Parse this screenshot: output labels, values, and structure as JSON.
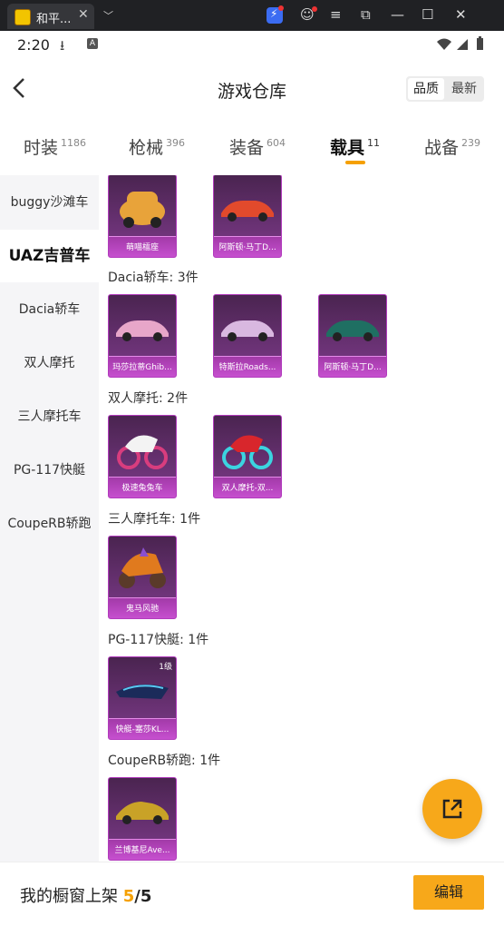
{
  "browser": {
    "tab_title": "和平...",
    "tab_close": "✕",
    "tab_dropdown": "﹀",
    "controls": [
      "≡",
      "⧉",
      "—",
      "☐",
      "✕"
    ],
    "colors": {
      "chrome_bg": "#202124",
      "ext_icon": "#3b6cf2"
    }
  },
  "status_bar": {
    "time": "2:20",
    "a_badge": "A",
    "icons": [
      "download-icon",
      "a-badge-icon",
      "wifi-icon",
      "signal-icon",
      "battery-icon"
    ]
  },
  "header": {
    "title": "游戏仓库",
    "sort_options": [
      "品质",
      "最新"
    ],
    "active_sort": "品质"
  },
  "category_tabs": [
    {
      "label": "时装",
      "count": "1186"
    },
    {
      "label": "枪械",
      "count": "396"
    },
    {
      "label": "装备",
      "count": "604"
    },
    {
      "label": "载具",
      "count": "11",
      "active": true
    },
    {
      "label": "战备",
      "count": "239"
    }
  ],
  "sidebar": {
    "items": [
      {
        "label": "buggy沙滩车"
      },
      {
        "label": "UAZ吉普车",
        "active": true
      },
      {
        "label": "Dacia轿车"
      },
      {
        "label": "双人摩托"
      },
      {
        "label": "三人摩托车"
      },
      {
        "label": "PG-117快艇"
      },
      {
        "label": "CoupeRB轿跑"
      }
    ]
  },
  "sections": [
    {
      "title": "",
      "items": [
        {
          "name": "萌喵檑座",
          "vehicle": "beetle-car",
          "color": "#e8a33a"
        },
        {
          "name": "阿斯顿·马丁D...",
          "vehicle": "sports-car",
          "color": "#e24a2c"
        }
      ]
    },
    {
      "title": "Dacia轿车: 3件",
      "items": [
        {
          "name": "玛莎拉蒂Ghib...",
          "vehicle": "sedan",
          "color": "#e7a6c9"
        },
        {
          "name": "特斯拉Roads...",
          "vehicle": "roadster",
          "color": "#d9b8e0"
        },
        {
          "name": "阿斯顿·马丁D...",
          "vehicle": "sports-car",
          "color": "#1f6f62"
        }
      ]
    },
    {
      "title": "双人摩托: 2件",
      "items": [
        {
          "name": "极速兔兔车",
          "vehicle": "motorbike",
          "color": "#f3f3f3"
        },
        {
          "name": "双人摩托-双...",
          "vehicle": "motorbike",
          "color": "#d8262c"
        }
      ]
    },
    {
      "title": "三人摩托车: 1件",
      "items": [
        {
          "name": "鬼马风驰",
          "vehicle": "trike",
          "color": "#e07a1e"
        }
      ]
    },
    {
      "title": "PG-117快艇: 1件",
      "items": [
        {
          "name": "快艇-塞莎KL...",
          "vehicle": "speedboat",
          "color": "#1b2b5a",
          "level": "1级"
        }
      ]
    },
    {
      "title": "CoupeRB轿跑: 1件",
      "items": [
        {
          "name": "兰博基尼Ave...",
          "vehicle": "supercar",
          "color": "#c9a227"
        }
      ]
    }
  ],
  "fab": {
    "icon": "external-link-icon"
  },
  "footer": {
    "label": "我的橱窗上架",
    "count": "5",
    "total": "/5",
    "edit_label": "编辑"
  },
  "accent_color": "#f7a81a"
}
